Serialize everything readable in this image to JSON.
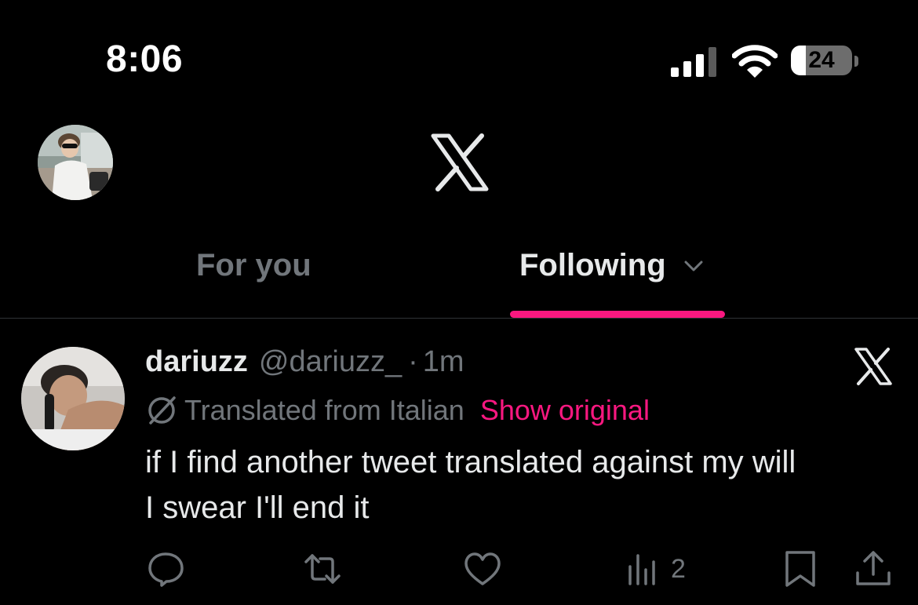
{
  "status_bar": {
    "time": "8:06",
    "battery_level": "24",
    "battery_fraction": 0.24
  },
  "header": {
    "logo_icon": "x-logo-icon",
    "profile_avatar_icon": "user-avatar"
  },
  "tabs": [
    {
      "label": "For you",
      "active": false
    },
    {
      "label": "Following",
      "active": true,
      "dropdown_icon": "chevron-down-icon"
    }
  ],
  "post": {
    "display_name": "dariuzz",
    "handle": "@dariuzz_",
    "separator": "·",
    "time_ago": "1m",
    "translated_label": "Translated from Italian",
    "show_original_label": "Show original",
    "text_line1": "if I find another tweet translated against my will",
    "text_line2": "I swear I'll end it",
    "views": "2"
  },
  "colors": {
    "background": "#000000",
    "text_primary": "#e7e9ea",
    "text_secondary": "#71767b",
    "accent": "#f91880",
    "divider": "#2f3336"
  }
}
